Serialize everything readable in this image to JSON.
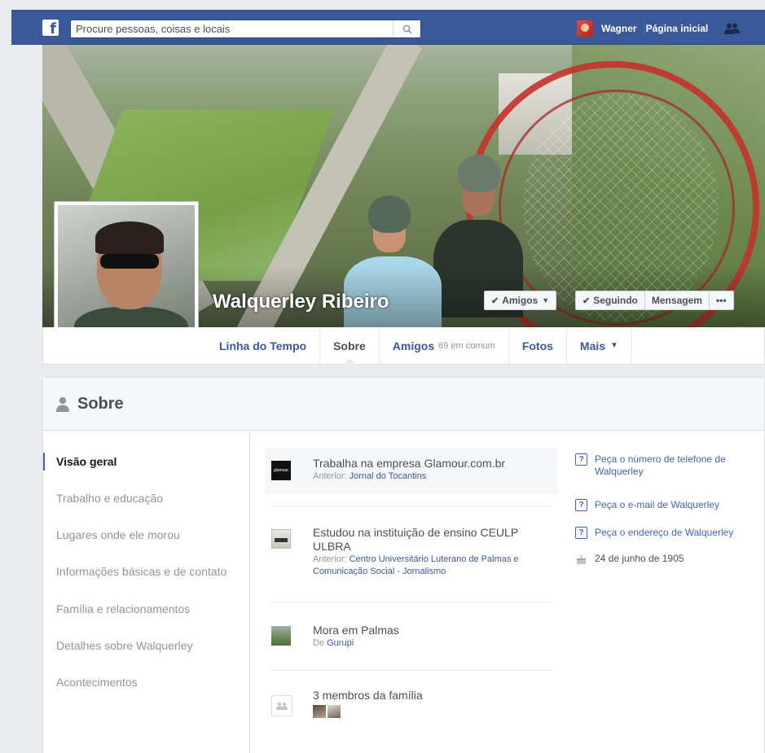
{
  "topbar": {
    "search_placeholder": "Procure pessoas, coisas e locais",
    "user_name": "Wagner",
    "home_label": "Página inicial"
  },
  "profile": {
    "name": "Walquerley Ribeiro"
  },
  "actions": {
    "friends_label": "Amigos",
    "following_label": "Seguindo",
    "message_label": "Mensagem",
    "more_label": "•••"
  },
  "tabs": [
    {
      "label": "Linha do Tempo",
      "sub": ""
    },
    {
      "label": "Sobre",
      "sub": ""
    },
    {
      "label": "Amigos",
      "sub": "69 em comum"
    },
    {
      "label": "Fotos",
      "sub": ""
    },
    {
      "label": "Mais",
      "sub": ""
    }
  ],
  "about": {
    "title": "Sobre",
    "nav": [
      "Visão geral",
      "Trabalho e educação",
      "Lugares onde ele morou",
      "Informações básicas e de contato",
      "Família e relacionamentos",
      "Detalhes sobre Walquerley",
      "Acontecimentos"
    ],
    "entries": {
      "work": {
        "prefix": "Trabalha na empresa ",
        "link": "Glamour.com.br",
        "sub_prefix": "Anterior: ",
        "sub_link": "Jornal do Tocantins",
        "icon_text": "glamour"
      },
      "education": {
        "main": "Estudou na instituição de ensino CEULP ULBRA",
        "sub_prefix": "Anterior: ",
        "sub_link": "Centro Universitário Luterano de Palmas e Comunicação Social - Jornalismo"
      },
      "home": {
        "prefix": "Mora em ",
        "link": "Palmas",
        "sub_prefix": "De ",
        "sub_link": "Gurupi"
      },
      "family": {
        "main": "3 membros da família"
      }
    },
    "side": {
      "phone": "Peça o número de telefone de Walquerley",
      "email": "Peça o e-mail de Walquerley",
      "address": "Peça o endereço de Walquerley",
      "birthday": "24 de junho de 1905"
    }
  },
  "colors": {
    "brand": "#3b5998",
    "link": "#4267b2"
  }
}
